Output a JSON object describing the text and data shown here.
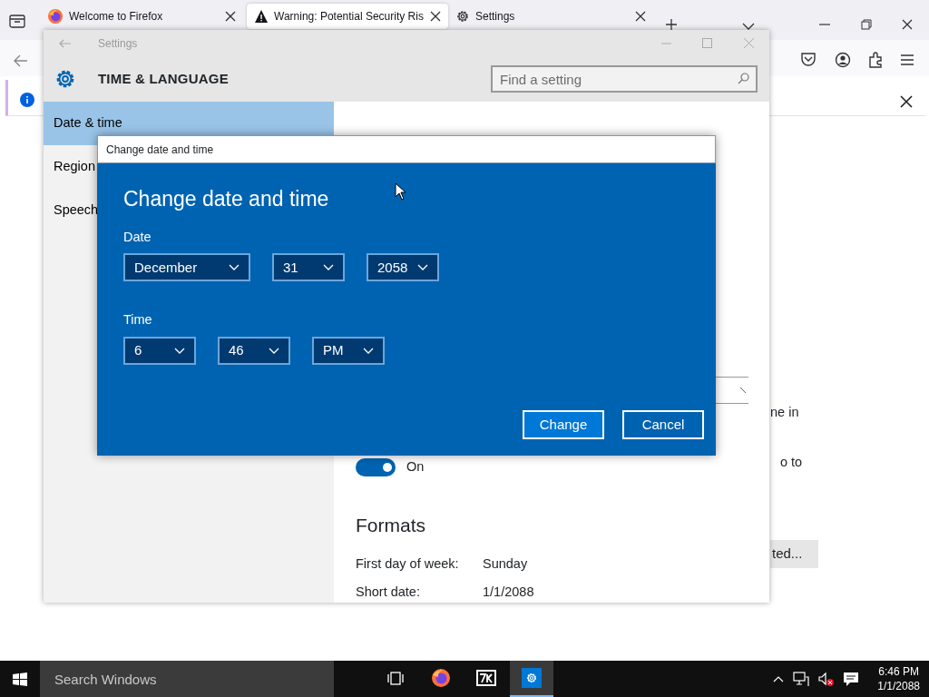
{
  "browser": {
    "tabs": [
      {
        "title": "Welcome to Firefox",
        "kind": "firefox",
        "selected": false
      },
      {
        "title": "Warning: Potential Security Ris",
        "kind": "warning",
        "selected": true
      },
      {
        "title": "Settings",
        "kind": "gear",
        "selected": false
      }
    ]
  },
  "settings": {
    "title": "Settings",
    "section": "TIME & LANGUAGE",
    "search": {
      "placeholder": "Find a setting"
    },
    "nav": [
      {
        "label": "Date & time",
        "selected": true
      },
      {
        "label": "Region",
        "selected": false
      },
      {
        "label": "Speech",
        "selected": false
      }
    ],
    "toggle": {
      "label": "On",
      "on": true
    },
    "formats_heading": "Formats",
    "formats": [
      {
        "label": "First day of week:",
        "value": "Sunday"
      },
      {
        "label": "Short date:",
        "value": "1/1/2088"
      }
    ],
    "clipped_texts": [
      "ne in",
      "o to"
    ],
    "clipped_button": "ted..."
  },
  "dialog": {
    "title": "Change date and time",
    "heading": "Change date and time",
    "date_label": "Date",
    "date": [
      "December",
      "31",
      "2058"
    ],
    "time_label": "Time",
    "time": [
      "6",
      "46",
      "PM"
    ],
    "buttons": [
      {
        "label": "Change",
        "primary": true
      },
      {
        "label": "Cancel",
        "primary": false
      }
    ]
  },
  "taskbar": {
    "search": {
      "placeholder": "Search Windows"
    },
    "apps": [
      {
        "kind": "taskview",
        "active": false
      },
      {
        "kind": "firefox",
        "active": false
      },
      {
        "kind": "archive",
        "active": false
      },
      {
        "kind": "settings",
        "active": true
      }
    ],
    "time": "6:46 PM",
    "date": "1/1/2088"
  }
}
